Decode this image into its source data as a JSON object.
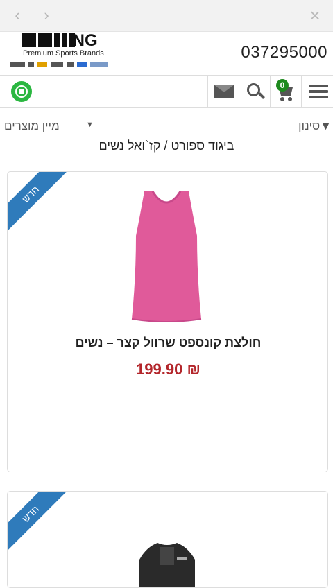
{
  "browser": {
    "back_icon": "chevron-left-icon",
    "forward_icon": "chevron-right-icon",
    "close_icon": "close-icon"
  },
  "header": {
    "logo_text": "ING",
    "logo_subtitle": "Premium Sports Brands",
    "phone": "037295000"
  },
  "toolbar": {
    "cart_count": "0",
    "icons": [
      "whatsapp-icon",
      "mail-icon",
      "search-icon",
      "cart-icon",
      "menu-icon"
    ]
  },
  "listing": {
    "sort_label": "מיין מוצרים",
    "sort_arrow": "▼",
    "filter_label": "▼סינון",
    "breadcrumb": "ביגוד ספורט / קז`ואל נשים"
  },
  "products": [
    {
      "badge": "חדש",
      "title": "חולצת קונספט שרוול קצר – נשים",
      "price": "199.90 ₪",
      "color": "#e05a9a"
    },
    {
      "badge": "חדש",
      "title": "",
      "price": "",
      "color": "#2a2a2a"
    }
  ],
  "colors": {
    "accent": "#2f7bbb",
    "price": "#b3262b",
    "whatsapp": "#2bb741",
    "cart_badge": "#1e8a1e"
  }
}
